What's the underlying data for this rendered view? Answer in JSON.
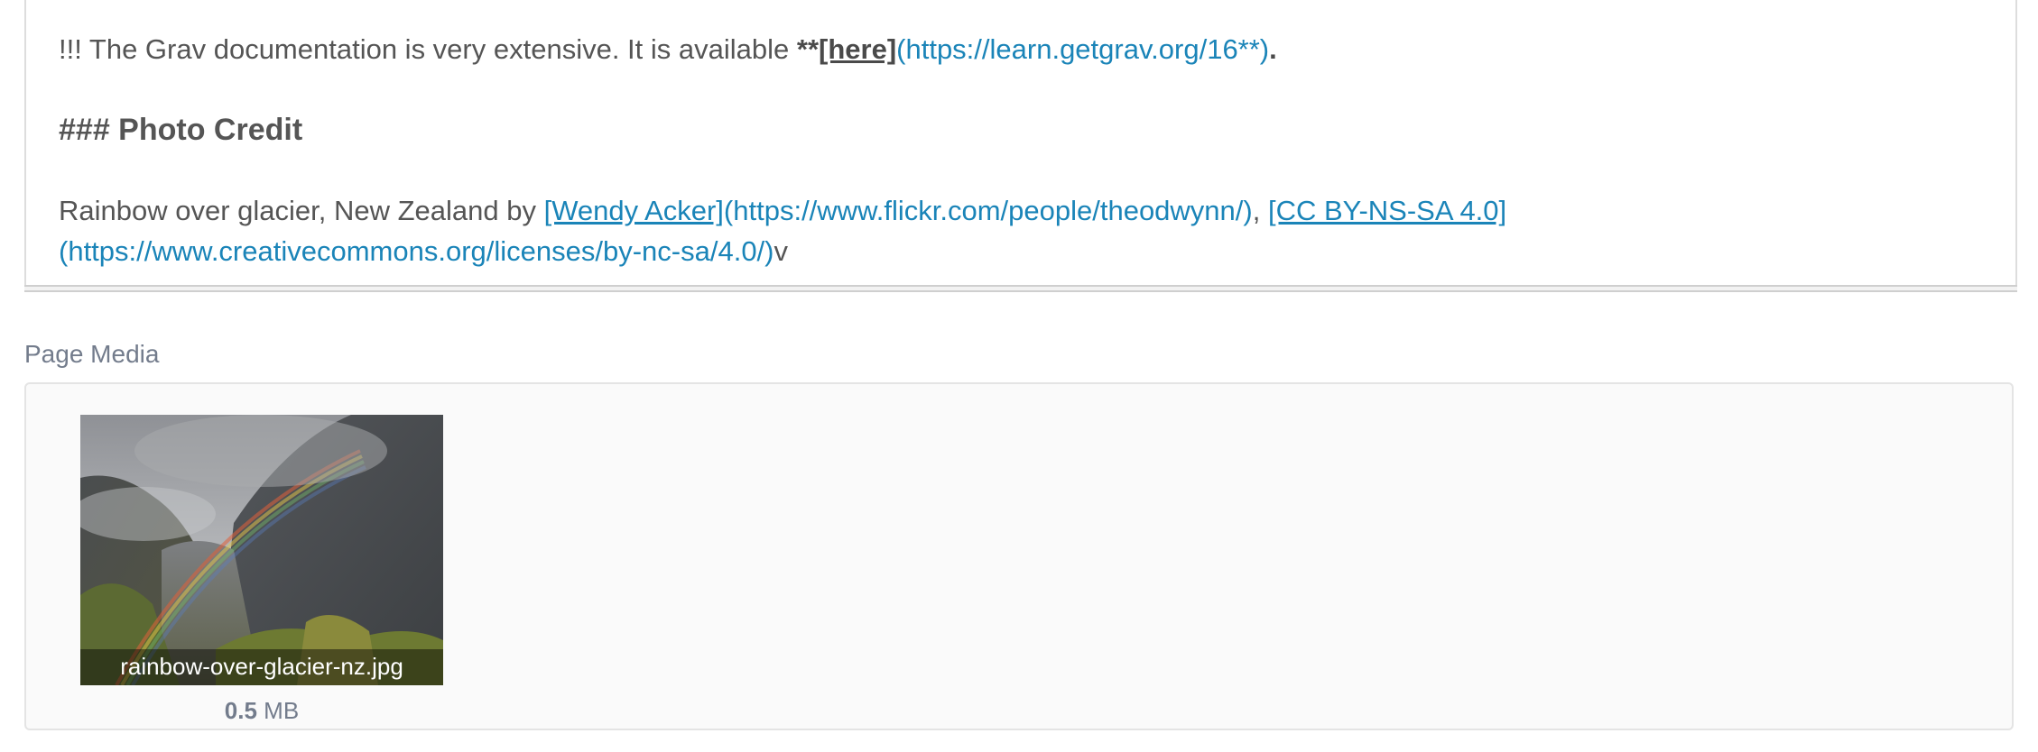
{
  "editor": {
    "line1": {
      "prefix": "!!! The Grav documentation is very extensive. It is available ",
      "bold_open": "**",
      "link_text": "[here]",
      "link_url": "(https://learn.getgrav.org/16**)",
      "suffix": "."
    },
    "line2": {
      "text": "### Photo Credit"
    },
    "line3": {
      "prefix": "Rainbow over glacier, New Zealand by ",
      "link1_text": "[Wendy Acker]",
      "link1_url": "(https://www.flickr.com/people/theodwynn/)",
      "separator": ", ",
      "link2_text": "[CC BY-NS-SA 4.0]"
    },
    "line4": {
      "link2_url": "(https://www.creativecommons.org/licenses/by-nc-sa/4.0/)",
      "suffix": "v"
    }
  },
  "page_media": {
    "label": "Page Media",
    "items": [
      {
        "filename": "rainbow-over-glacier-nz.jpg",
        "size_value": "0.5",
        "size_unit": " MB"
      }
    ]
  }
}
